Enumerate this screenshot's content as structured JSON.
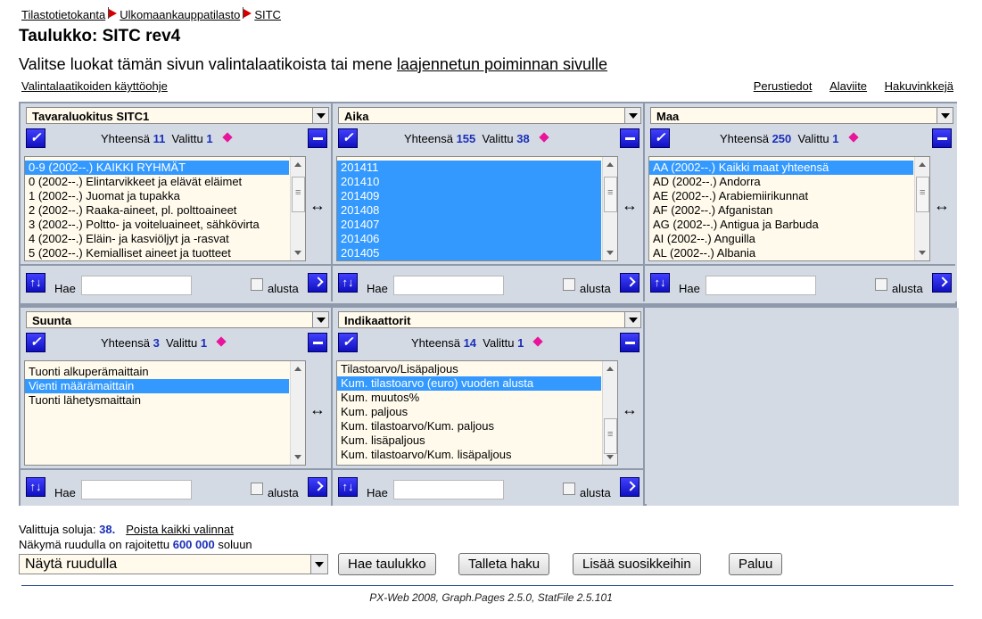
{
  "breadcrumb": [
    "Tilastotietokanta",
    "Ulkomaankauppatilasto",
    "SITC"
  ],
  "title": "Taulukko: SITC rev4",
  "intro_text": "Valitse luokat tämän sivun valintalaatikoista tai mene ",
  "intro_link": "laajennetun poiminnan sivulle",
  "help_link": "Valintalaatikoiden käyttöohje",
  "top_links": [
    "Perustiedot",
    "Alaviite",
    "Hakuvinkkejä"
  ],
  "labels": {
    "total": "Yhteensä",
    "selected": "Valittu",
    "search": "Hae",
    "from_start": "alusta"
  },
  "panels": [
    {
      "name": "Tavaraluokitus SITC1",
      "total": "11",
      "selected": "1",
      "options": [
        {
          "text": "0-9 (2002--.) KAIKKI RYHMÄT",
          "selected": true
        },
        {
          "text": "0 (2002--.) Elintarvikkeet ja elävät eläimet",
          "selected": false
        },
        {
          "text": "1 (2002--.) Juomat ja tupakka",
          "selected": false
        },
        {
          "text": "2 (2002--.) Raaka-aineet, pl. polttoaineet",
          "selected": false
        },
        {
          "text": "3 (2002--.) Poltto- ja voiteluaineet, sähkövirta",
          "selected": false
        },
        {
          "text": "4 (2002--.) Eläin- ja kasviöljyt ja -rasvat",
          "selected": false
        },
        {
          "text": "5 (2002--.) Kemialliset aineet ja tuotteet",
          "selected": false
        }
      ]
    },
    {
      "name": "Aika",
      "total": "155",
      "selected": "38",
      "options": [
        {
          "text": "201411",
          "selected": true
        },
        {
          "text": "201410",
          "selected": true
        },
        {
          "text": "201409",
          "selected": true
        },
        {
          "text": "201408",
          "selected": true
        },
        {
          "text": "201407",
          "selected": true
        },
        {
          "text": "201406",
          "selected": true
        },
        {
          "text": "201405",
          "selected": true
        }
      ]
    },
    {
      "name": "Maa",
      "total": "250",
      "selected": "1",
      "options": [
        {
          "text": "AA (2002--.) Kaikki maat yhteensä",
          "selected": true
        },
        {
          "text": "AD (2002--.) Andorra",
          "selected": false
        },
        {
          "text": "AE (2002--.) Arabiemiirikunnat",
          "selected": false
        },
        {
          "text": "AF (2002--.) Afganistan",
          "selected": false
        },
        {
          "text": "AG (2002--.) Antigua ja Barbuda",
          "selected": false
        },
        {
          "text": "AI (2002--.) Anguilla",
          "selected": false
        },
        {
          "text": "AL (2002--.) Albania",
          "selected": false
        }
      ]
    },
    {
      "name": "Suunta",
      "total": "3",
      "selected": "1",
      "options": [
        {
          "text": "Tuonti alkuperämaittain",
          "selected": false
        },
        {
          "text": "Vienti määrämaittain",
          "selected": true
        },
        {
          "text": "Tuonti lähetysmaittain",
          "selected": false
        }
      ]
    },
    {
      "name": "Indikaattorit",
      "total": "14",
      "selected": "1",
      "options": [
        {
          "text": "Tilastoarvo/Lisäpaljous",
          "selected": false
        },
        {
          "text": "Kum. tilastoarvo (euro) vuoden alusta",
          "selected": true
        },
        {
          "text": "Kum. muutos%",
          "selected": false
        },
        {
          "text": "Kum. paljous",
          "selected": false
        },
        {
          "text": "Kum. tilastoarvo/Kum. paljous",
          "selected": false
        },
        {
          "text": "Kum. lisäpaljous",
          "selected": false
        },
        {
          "text": "Kum. tilastoarvo/Kum. lisäpaljous",
          "selected": false
        }
      ]
    }
  ],
  "cells_label": "Valittuja soluja:",
  "cells_count": "38.",
  "clear_link": "Poista kaikki valinnat",
  "limit_text": "Näkymä ruudulla on rajoitettu",
  "limit_value": "600 000",
  "limit_unit": "soluun",
  "output_select": "Näytä ruudulla",
  "buttons": {
    "fetch": "Hae taulukko",
    "save": "Talleta haku",
    "favorite": "Lisää suosikkeihin",
    "back": "Paluu"
  },
  "footer": "PX-Web 2008, Graph.Pages 2.5.0, StatFile 2.5.101"
}
